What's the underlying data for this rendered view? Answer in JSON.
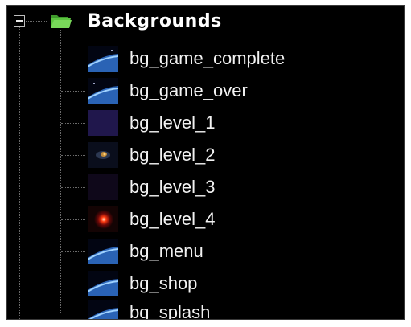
{
  "tree": {
    "root": {
      "label": "Backgrounds",
      "expander": "minus",
      "icon": "folder-open-icon",
      "icon_color": "#52b83a"
    },
    "items": [
      {
        "label": "bg_game_complete",
        "thumbnail": "planet-horizon"
      },
      {
        "label": "bg_game_over",
        "thumbnail": "planet-horizon"
      },
      {
        "label": "bg_level_1",
        "thumbnail": "purple-space"
      },
      {
        "label": "bg_level_2",
        "thumbnail": "galaxy"
      },
      {
        "label": "bg_level_3",
        "thumbnail": "dark-space"
      },
      {
        "label": "bg_level_4",
        "thumbnail": "red-star"
      },
      {
        "label": "bg_menu",
        "thumbnail": "planet-horizon"
      },
      {
        "label": "bg_shop",
        "thumbnail": "planet-horizon"
      },
      {
        "label": "bg_splash",
        "thumbnail": "planet-horizon"
      }
    ]
  }
}
